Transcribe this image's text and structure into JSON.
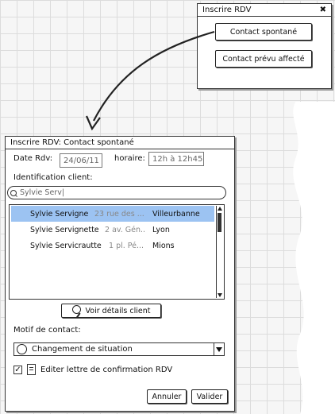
{
  "top_window": {
    "title": "Inscrire RDV",
    "button_spontane": "Contact spontané",
    "button_prevu": "Contact prévu affecté"
  },
  "main_window": {
    "title": "Inscrire RDV: Contact spontané",
    "date_label": "Date Rdv:",
    "date_value": "24/06/11",
    "horaire_label": "horaire:",
    "horaire_value": "12h à 12h45",
    "ident_label": "Identification client:",
    "search_value": "Sylvie Serv|",
    "clients": [
      {
        "name": "Sylvie Servigne",
        "address": "23 rue des ...",
        "city": "Villeurbanne"
      },
      {
        "name": "Sylvie Servignette",
        "address": "2 av. Gén..",
        "city": "Lyon"
      },
      {
        "name": "Sylvie Servicrautte",
        "address": "1 pl. Pé...",
        "city": "Mions"
      }
    ],
    "details_button": "Voir détails client",
    "motif_label": "Motif de contact:",
    "motif_value": "Changement de situation",
    "checkbox_label": "Editer lettre de confirmation RDV",
    "cancel_button": "Annuler",
    "validate_button": "Valider"
  }
}
